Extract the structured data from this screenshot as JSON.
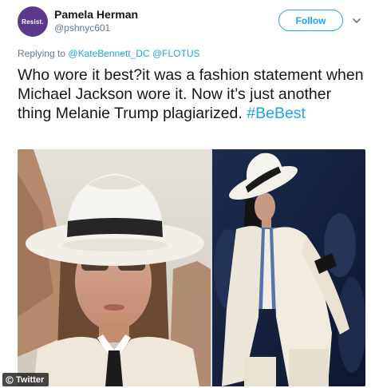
{
  "author": {
    "avatar_text": "Resist.",
    "display_name": "Pamela Herman",
    "handle": "@pshnyc601"
  },
  "follow_label": "Follow",
  "reply": {
    "prefix": "Replying to",
    "mentions": "@KateBennett_DC @FLOTUS"
  },
  "tweet": {
    "text": "Who wore it best?it was a fashion statement when Michael Jackson wore it. Now it’s just another thing Melanie Trump plagiarized.",
    "hashtag": "#BeBest"
  },
  "watermark": "Twitter",
  "colors": {
    "accent": "#1da1f2",
    "avatar": "#5b3a8c",
    "secondary_text": "#657786"
  },
  "icons": {
    "menu": "chevron-down-icon",
    "watermark": "copyright-icon"
  }
}
